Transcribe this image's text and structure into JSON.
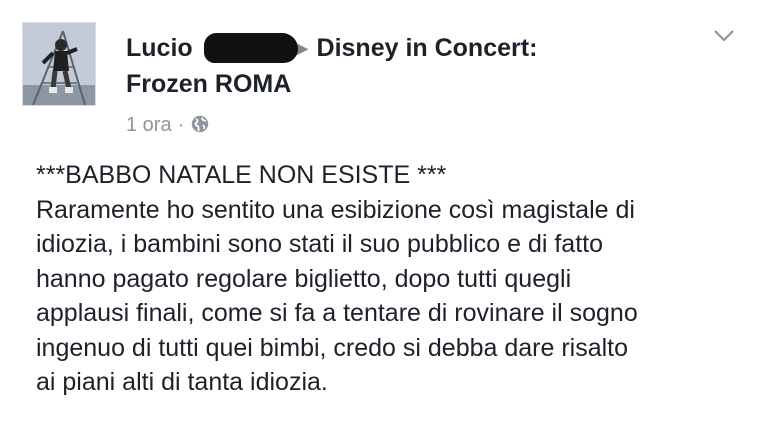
{
  "post": {
    "author": "Lucio",
    "separator_icon": "right-triangle-icon",
    "group_line1": "Disney in Concert:",
    "group_line2": "Frozen ROMA",
    "timestamp": "1 ora",
    "meta_separator": "·",
    "privacy_icon": "globe-icon",
    "menu_icon": "chevron-down-icon",
    "body_lines": [
      "***BABBO NATALE NON ESISTE ***",
      "Raramente ho sentito una esibizione così magistale di",
      "idiozia, i bambini sono stati il suo pubblico e di fatto",
      "hanno pagato regolare biglietto, dopo tutti quegli",
      "applausi finali, come si fa a tentare di rovinare il sogno",
      "ingenuo di tutti quei bimbi, credo si debba dare risalto",
      "ai piani alti di tanta idiozia."
    ]
  },
  "colors": {
    "text": "#1d2129",
    "meta_text": "#90949c",
    "redaction": "#111111"
  }
}
